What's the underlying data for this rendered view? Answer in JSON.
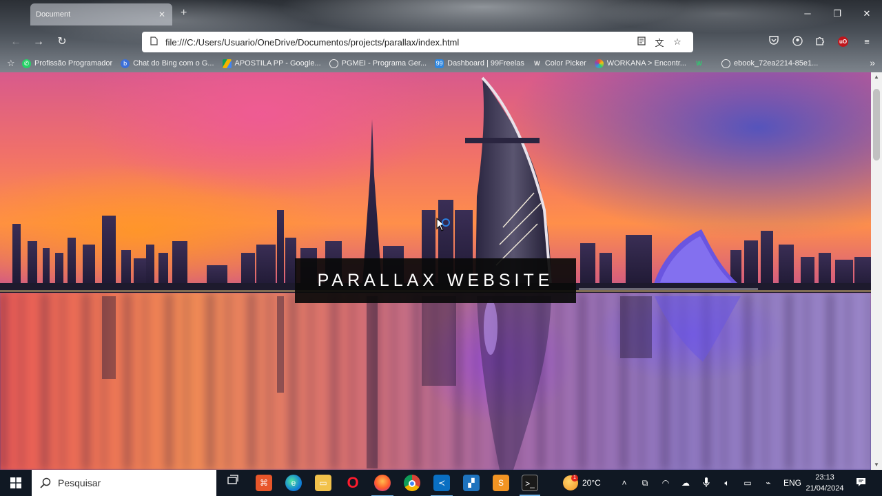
{
  "browser": {
    "tab_title": "Document",
    "tab_close": "✕",
    "new_tab": "+",
    "url": "file:///C:/Users/Usuario/OneDrive/Documentos/projects/parallax/index.html",
    "bookmarks": [
      {
        "label": "Profissão Programador",
        "icon": "whatsapp-icon",
        "color": "#25d366"
      },
      {
        "label": "Chat do Bing com o G...",
        "icon": "bing-icon",
        "color": "#3b6fd8"
      },
      {
        "label": "APOSTILA PP - Google...",
        "icon": "drive-icon",
        "color": "#f4b400"
      },
      {
        "label": "PGMEI - Programa Ger...",
        "icon": "globe-icon",
        "color": "transparent"
      },
      {
        "label": "Dashboard | 99Freelas",
        "icon": "freelas-icon",
        "color": "#2e86de"
      },
      {
        "label": "Color Picker",
        "icon": "w-icon",
        "color": "transparent"
      },
      {
        "label": "WORKANA > Encontr...",
        "icon": "workana-icon",
        "color": "#8e44ad"
      },
      {
        "label": "",
        "icon": "w-green-icon",
        "color": "transparent"
      },
      {
        "label": "ebook_72ea2214-85e1...",
        "icon": "globe-icon",
        "color": "transparent"
      }
    ],
    "more_bookmarks": "»"
  },
  "page": {
    "hero_title": "PARALLAX WEBSITE"
  },
  "taskbar": {
    "search_placeholder": "Pesquisar",
    "weather": "20°C",
    "language": "ENG",
    "time": "23:13",
    "date": "21/04/2024",
    "weather_badge": "1"
  },
  "colors": {
    "hero_box": "#0a0a0a",
    "taskbar": "#101823",
    "ublock": "#c0161c"
  }
}
